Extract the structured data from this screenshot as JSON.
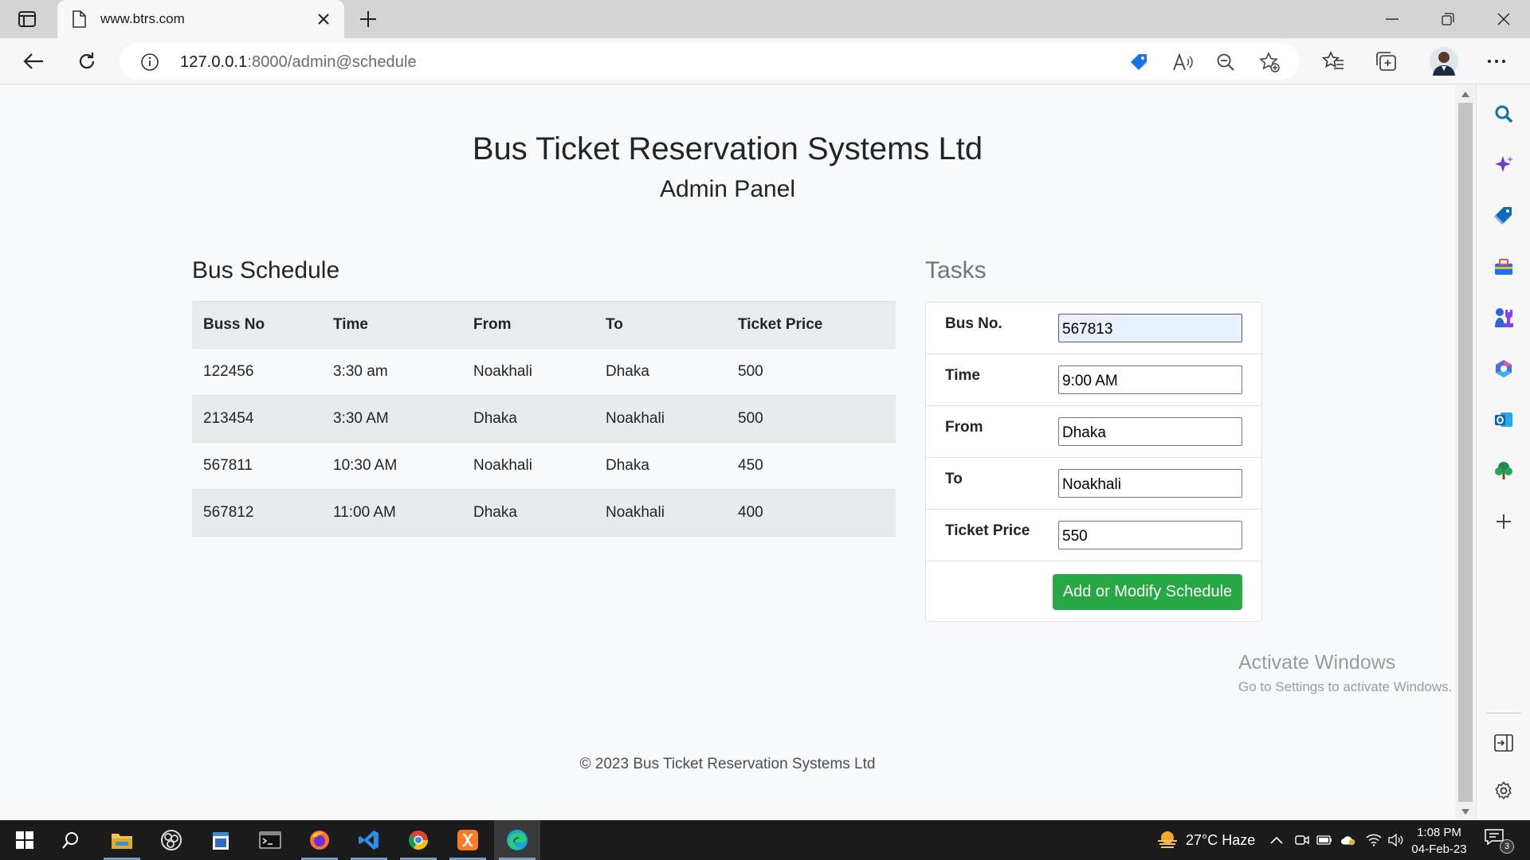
{
  "browser": {
    "tab_title": "www.btrs.com",
    "url_host": "127.0.0.1",
    "url_rest": ":8000/admin@schedule"
  },
  "page": {
    "title": "Bus Ticket Reservation Systems Ltd",
    "subtitle": "Admin Panel",
    "schedule": {
      "heading": "Bus Schedule",
      "columns": [
        "Buss No",
        "Time",
        "From",
        "To",
        "Ticket Price"
      ],
      "rows": [
        [
          "122456",
          "3:30 am",
          "Noakhali",
          "Dhaka",
          "500"
        ],
        [
          "213454",
          "3:30 AM",
          "Dhaka",
          "Noakhali",
          "500"
        ],
        [
          "567811",
          "10:30 AM",
          "Noakhali",
          "Dhaka",
          "450"
        ],
        [
          "567812",
          "11:00 AM",
          "Dhaka",
          "Noakhali",
          "400"
        ]
      ]
    },
    "tasks": {
      "heading": "Tasks",
      "fields": [
        {
          "label": "Bus No.",
          "value": "567813"
        },
        {
          "label": "Time",
          "value": "9:00 AM"
        },
        {
          "label": "From",
          "value": "Dhaka"
        },
        {
          "label": "To",
          "value": "Noakhali"
        },
        {
          "label": "Ticket Price",
          "value": "550"
        }
      ],
      "submit_label": "Add or Modify Schedule"
    },
    "footer": "© 2023 Bus Ticket Reservation Systems Ltd"
  },
  "watermark": {
    "line1": "Activate Windows",
    "line2": "Go to Settings to activate Windows."
  },
  "taskbar": {
    "weather": "27°C  Haze",
    "time": "1:08 PM",
    "date": "04-Feb-23",
    "notification_count": "3"
  },
  "colors": {
    "accent_green": "#28a745",
    "edge_blue": "#0f6cbd"
  }
}
